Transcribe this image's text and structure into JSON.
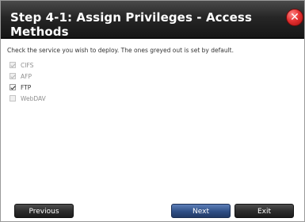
{
  "dialog": {
    "title": "Step 4-1: Assign Privileges - Access Methods",
    "instruction": "Check the service you wish to deploy. The ones greyed out is set by default.",
    "options": [
      {
        "label": "CIFS",
        "checked": true,
        "disabled": true
      },
      {
        "label": "AFP",
        "checked": true,
        "disabled": true
      },
      {
        "label": "FTP",
        "checked": true,
        "disabled": false
      },
      {
        "label": "WebDAV",
        "checked": false,
        "disabled": true
      }
    ],
    "buttons": {
      "previous": "Previous",
      "next": "Next",
      "exit": "Exit"
    }
  },
  "colors": {
    "titlebar": "#1f1f1f",
    "close": "#e53232",
    "next_button": "#2f4f86"
  },
  "icons": {
    "close": "close-icon"
  }
}
